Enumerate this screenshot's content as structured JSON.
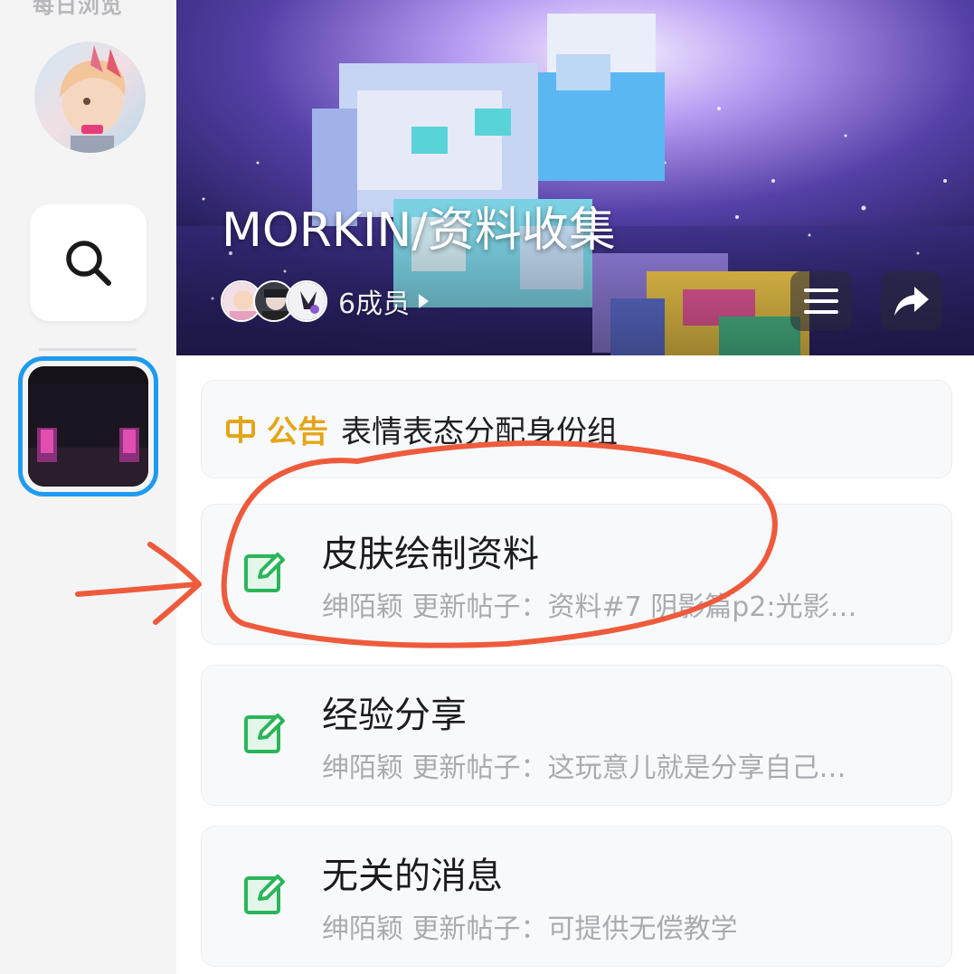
{
  "sidebar": {
    "top_label": "每日浏览",
    "search_icon": "search-icon",
    "server_icon": "enderman-face-icon"
  },
  "banner": {
    "title": "MORKIN/资料收集",
    "member_count": "6成员",
    "menu_icon": "hamburger-menu-icon",
    "share_icon": "share-arrow-icon"
  },
  "notice": {
    "icon": "notice-icon",
    "label": "公告",
    "text": "表情表态分配身份组"
  },
  "channels": [
    {
      "name": "皮肤绘制资料",
      "preview": "绅陌颖 更新帖子：资料#7 阴影篇p2:光影…",
      "icon": "edit-note-icon"
    },
    {
      "name": "经验分享",
      "preview": "绅陌颖 更新帖子：这玩意儿就是分享自己…",
      "icon": "edit-note-icon"
    },
    {
      "name": "无关的消息",
      "preview": "绅陌颖 更新帖子：可提供无偿教学",
      "icon": "edit-note-icon"
    }
  ],
  "colors": {
    "accent_blue": "#1e9bef",
    "notice_gold": "#e3a619",
    "channel_green": "#2bb55a",
    "annotation_red": "#ee5a3c"
  }
}
